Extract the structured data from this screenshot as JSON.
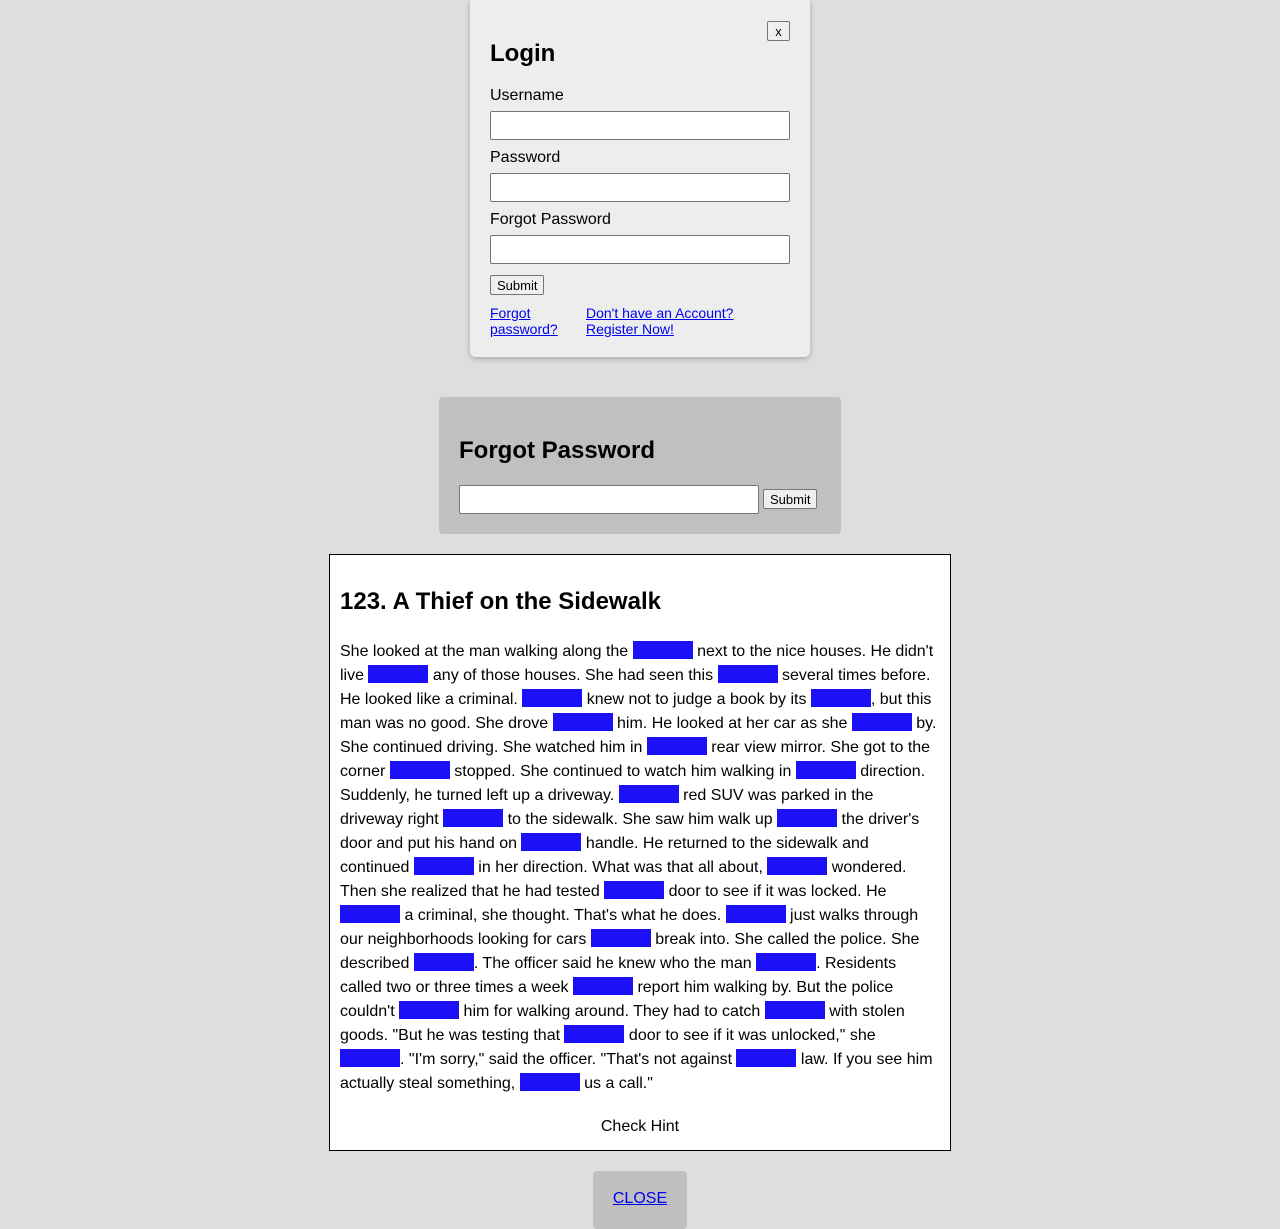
{
  "login": {
    "close_label": "x",
    "title": "Login",
    "username_label": "Username",
    "username_value": "",
    "password_label": "Password",
    "password_value": "",
    "forgot_label": "Forgot Password",
    "forgot_value": "",
    "submit_label": "Submit",
    "forgot_link_line1": "Forgot",
    "forgot_link_line2": "password?",
    "register_link_line1": "Don't have an Account?",
    "register_link_line2": "Register Now!"
  },
  "forgot_panel": {
    "title": "Forgot Password",
    "email_value": "",
    "submit_label": "Submit"
  },
  "story": {
    "title": "123. A Thief on the Sidewalk",
    "segments": [
      "She looked at the man walking along the ",
      " next to the nice houses. He didn't live ",
      " any of those houses. She had seen this ",
      " several times before. He looked like a criminal. ",
      " knew not to judge a book by its ",
      ", but this man was no good. She drove ",
      " him. He looked at her car as she ",
      " by. She continued driving. She watched him in ",
      " rear view mirror. She got to the corner ",
      " stopped. She continued to watch him walking in ",
      " direction. Suddenly, he turned left up a driveway. ",
      " red SUV was parked in the driveway right ",
      " to the sidewalk. She saw him walk up ",
      " the driver's door and put his hand on ",
      " handle. He returned to the sidewalk and continued ",
      " in her direction. What was that all about, ",
      " wondered. Then she realized that he had tested ",
      " door to see if it was locked. He ",
      " a criminal, she thought. That's what he does. ",
      " just walks through our neighborhoods looking for cars ",
      " break into. She called the police. She described ",
      ". The officer said he knew who the man ",
      ". Residents called two or three times a week ",
      " report him walking by. But the police couldn't ",
      " him for walking around. They had to catch ",
      " with stolen goods. \"But he was testing that ",
      " door to see if it was unlocked,\" she ",
      ". \"I'm sorry,\" said the officer. \"That's not against ",
      " law. If you see him actually steal something, ",
      " us a call.\""
    ],
    "check_hint_label": "Check Hint"
  },
  "close_bottom_label": "CLOSE",
  "colors": {
    "page_bg": "#dedede",
    "login_bg": "#ededed",
    "forgot_bg": "#c0c0c0",
    "blank_fill": "#1b10f8",
    "link": "#0000ee"
  }
}
